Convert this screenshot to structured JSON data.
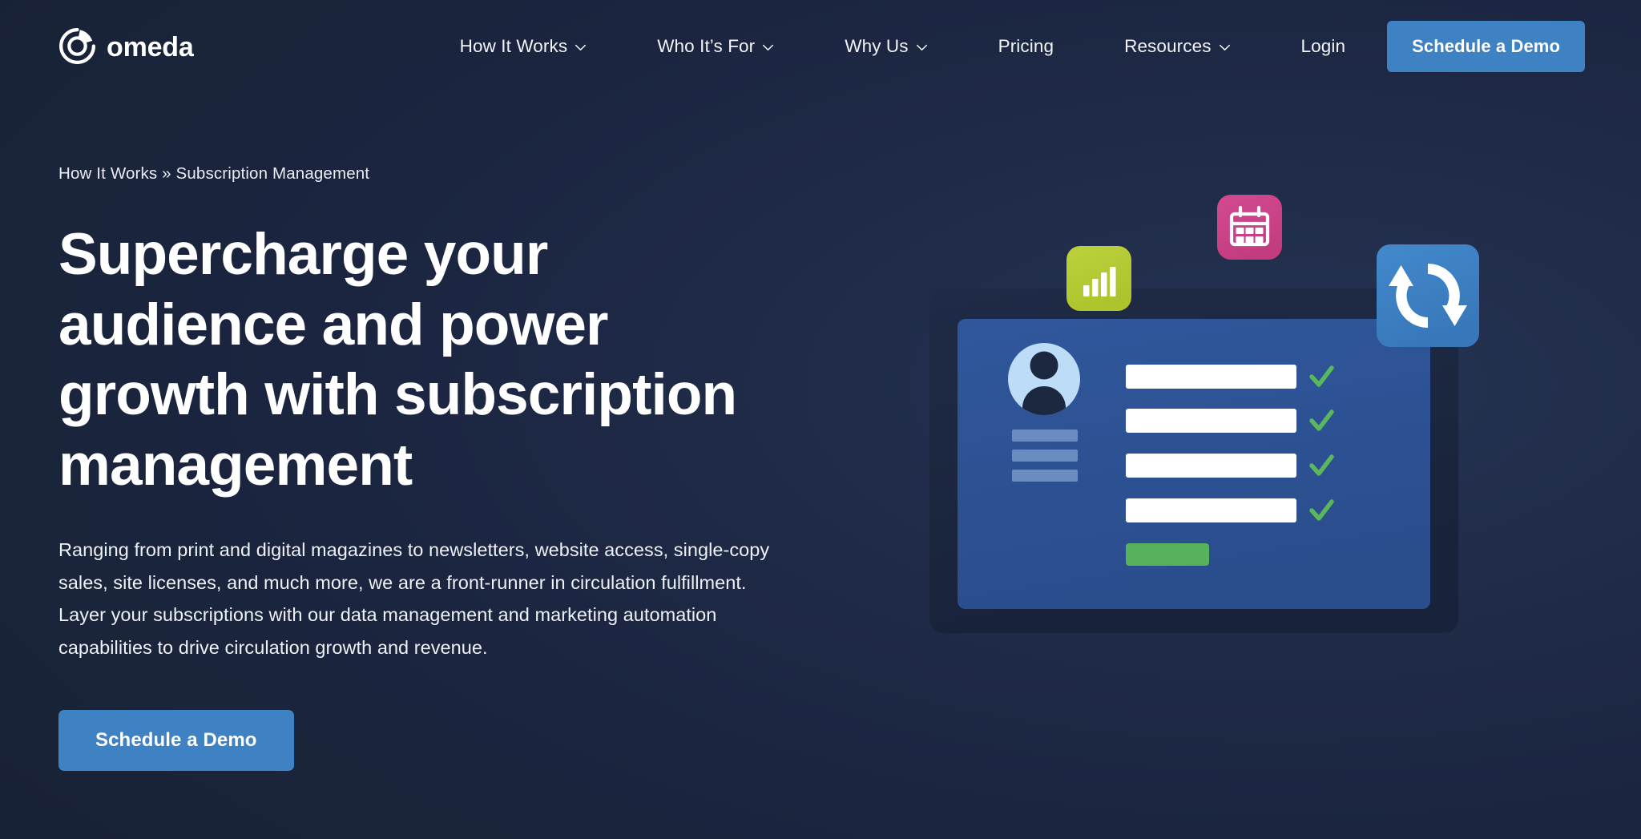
{
  "brand": {
    "name": "omeda",
    "logo_icon": "omeda-circle-logo",
    "accent_blue": "#3e82c4",
    "background_navy": "#192338"
  },
  "header": {
    "nav_items": [
      {
        "label": "How It Works",
        "has_dropdown": true,
        "icon": "chevron-down-icon"
      },
      {
        "label": "Who It’s For",
        "has_dropdown": true,
        "icon": "chevron-down-icon"
      },
      {
        "label": "Why Us",
        "has_dropdown": true,
        "icon": "chevron-down-icon"
      },
      {
        "label": "Pricing",
        "has_dropdown": false
      },
      {
        "label": "Resources",
        "has_dropdown": true,
        "icon": "chevron-down-icon"
      }
    ],
    "login_label": "Login",
    "demo_button_label": "Schedule a Demo"
  },
  "hero": {
    "breadcrumb": "How It Works » Subscription Management",
    "breadcrumb_parts": [
      "How It Works",
      "»",
      "Subscription Management"
    ],
    "headline": "Supercharge your audience and power growth with subscription management",
    "paragraph": "Ranging from print and digital magazines to newsletters, website access, single-copy sales, site licenses, and much more, we are a front-runner in circulation fulfillment. Layer your subscriptions with our data management and marketing automation capabilities to drive circulation growth and revenue.",
    "cta_label": "Schedule a Demo"
  },
  "illustration": {
    "name": "subscription-management-illustration",
    "device": {
      "frame_color": "#1c2740",
      "screen_color": "#2e5496"
    },
    "tiles": [
      {
        "icon": "bar-chart-icon",
        "color": "#b5cc34"
      },
      {
        "icon": "calendar-icon",
        "color": "#cc4388"
      },
      {
        "icon": "sync-refresh-icon",
        "color": "#3e82c4"
      }
    ],
    "screen": {
      "avatar_icon": "user-avatar-icon",
      "avatar_bg": "#bcdcf7",
      "placeholder_bar_color": "#6b8cc0",
      "placeholder_bar_count": 3,
      "field_rows": 4,
      "field_color": "#ffffff",
      "check_icon": "check-icon",
      "check_color": "#5bb75b",
      "submit_button_color": "#56b35c"
    }
  }
}
